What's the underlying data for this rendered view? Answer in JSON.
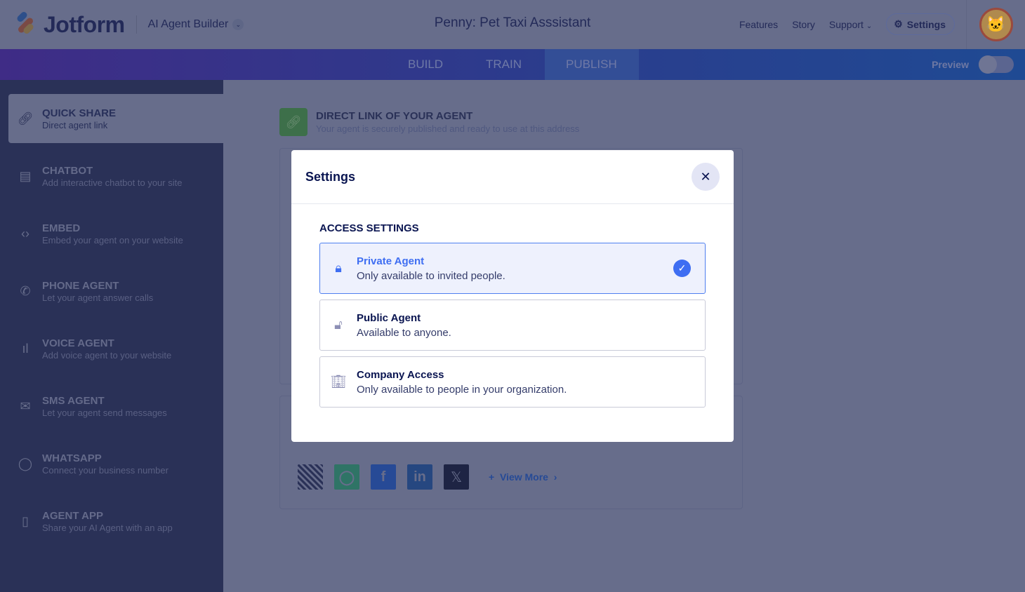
{
  "header": {
    "brand": "Jotform",
    "product": "AI Agent Builder",
    "title": "Penny: Pet Taxi Asssistant",
    "nav": [
      "Features",
      "Story",
      "Support"
    ],
    "settings_label": "Settings"
  },
  "tabs": {
    "items": [
      "BUILD",
      "TRAIN",
      "PUBLISH"
    ],
    "active": "PUBLISH",
    "preview_label": "Preview",
    "preview_on": false
  },
  "sidebar": {
    "items": [
      {
        "title": "QUICK SHARE",
        "subtitle": "Direct agent link",
        "icon": "link-icon",
        "active": true
      },
      {
        "title": "CHATBOT",
        "subtitle": "Add interactive chatbot to your site",
        "icon": "chat-icon"
      },
      {
        "title": "EMBED",
        "subtitle": "Embed your agent on your website",
        "icon": "code-icon"
      },
      {
        "title": "PHONE AGENT",
        "subtitle": "Let your agent answer calls",
        "icon": "phone-icon"
      },
      {
        "title": "VOICE AGENT",
        "subtitle": "Add voice agent to your website",
        "icon": "voice-icon"
      },
      {
        "title": "SMS AGENT",
        "subtitle": "Let your agent send messages",
        "icon": "sms-icon"
      },
      {
        "title": "WHATSAPP",
        "subtitle": "Connect your business number",
        "icon": "whatsapp-icon"
      },
      {
        "title": "AGENT APP",
        "subtitle": "Share your AI Agent with an app",
        "icon": "mobile-icon"
      }
    ]
  },
  "main": {
    "direct_link_title": "DIRECT LINK OF YOUR AGENT",
    "direct_link_subtitle": "Your agent is securely published and ready to use at this address",
    "view_more": "View More",
    "share_icons": [
      "qr-code-icon",
      "whatsapp-icon",
      "facebook-icon",
      "linkedin-icon",
      "x-icon"
    ]
  },
  "modal": {
    "title": "Settings",
    "section": "ACCESS SETTINGS",
    "options": [
      {
        "title": "Private Agent",
        "desc": "Only available to invited people.",
        "icon": "lock-icon",
        "selected": true
      },
      {
        "title": "Public Agent",
        "desc": "Available to anyone.",
        "icon": "unlock-icon",
        "selected": false
      },
      {
        "title": "Company Access",
        "desc": "Only available to people in your organization.",
        "icon": "building-icon",
        "selected": false
      }
    ]
  },
  "colors": {
    "accent": "#3e6ef2",
    "text": "#0a1551"
  }
}
